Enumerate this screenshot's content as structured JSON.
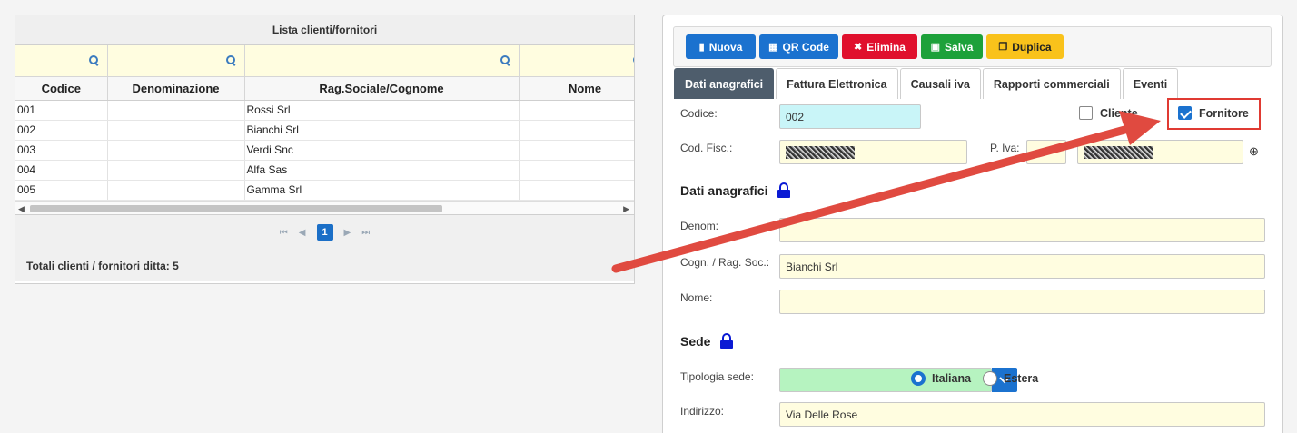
{
  "grid": {
    "title": "Lista clienti/fornitori",
    "columns": [
      "Codice",
      "Denominazione",
      "Rag.Sociale/Cognome",
      "Nome"
    ],
    "rows": [
      {
        "codice": "001",
        "denominazione": "",
        "ragione": "Rossi Srl",
        "nome": ""
      },
      {
        "codice": "002",
        "denominazione": "",
        "ragione": "Bianchi Srl",
        "nome": ""
      },
      {
        "codice": "003",
        "denominazione": "",
        "ragione": "Verdi Snc",
        "nome": ""
      },
      {
        "codice": "004",
        "denominazione": "",
        "ragione": "Alfa Sas",
        "nome": ""
      },
      {
        "codice": "005",
        "denominazione": "",
        "ragione": "Gamma Srl",
        "nome": ""
      }
    ],
    "current_page": "1",
    "footer": "Totali clienti / fornitori ditta: 5"
  },
  "toolbar": {
    "new_label": "Nuova",
    "qr_label": "QR Code",
    "delete_label": "Elimina",
    "save_label": "Salva",
    "duplicate_label": "Duplica"
  },
  "tabs": [
    "Dati anagrafici",
    "Fattura Elettronica",
    "Causali iva",
    "Rapporti commerciali",
    "Eventi"
  ],
  "form": {
    "codice_label": "Codice:",
    "codice_value": "002",
    "cliente_label": "Cliente",
    "cliente_checked": false,
    "fornitore_label": "Fornitore",
    "fornitore_checked": true,
    "codfisc_label": "Cod. Fisc.:",
    "piva_label": "P. Iva:",
    "section_anagrafici": "Dati anagrafici",
    "denom_label": "Denom:",
    "denom_value": "",
    "cogn_label": "Cogn. / Rag. Soc.:",
    "cogn_value": "Bianchi Srl",
    "nome_label": "Nome:",
    "nome_value": "",
    "section_sede": "Sede",
    "tipologia_label": "Tipologia sede:",
    "tipologia_value": "",
    "italiana_label": "Italiana",
    "italiana_selected": true,
    "estera_label": "Estera",
    "indirizzo_label": "Indirizzo:",
    "indirizzo_value": "Via Delle Rose"
  },
  "colors": {
    "primary": "#1b72cf",
    "danger": "#e0102d",
    "success": "#1da13a",
    "warning": "#f9c21b",
    "highlight": "#e03a32"
  }
}
